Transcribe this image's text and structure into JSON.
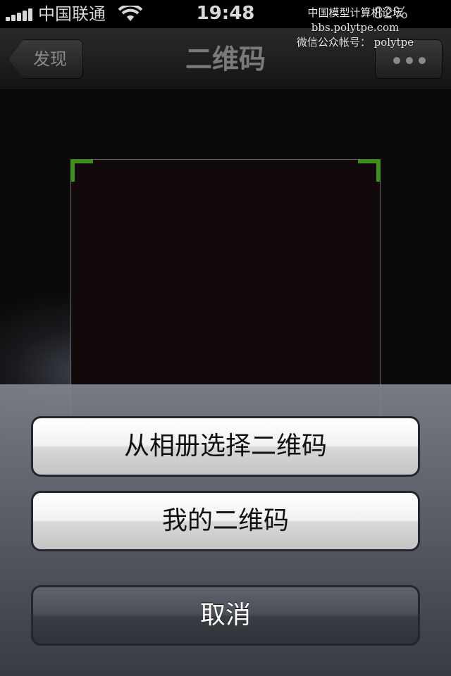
{
  "status_bar": {
    "carrier": "中国联通",
    "time": "19:48",
    "battery_percent": "82%"
  },
  "watermark": {
    "line1": "中国模型计算机论坛",
    "line2": "bbs.polytpe.com",
    "line3": "微信公众帐号： polytpe"
  },
  "nav": {
    "back_label": "发现",
    "title": "二维码"
  },
  "action_sheet": {
    "choose_from_album": "从相册选择二维码",
    "my_qr_code": "我的二维码",
    "cancel": "取消"
  },
  "colors": {
    "scan_corner": "#3f8f1a"
  },
  "icons": [
    "signal-icon",
    "wifi-icon",
    "more-dots-icon"
  ]
}
